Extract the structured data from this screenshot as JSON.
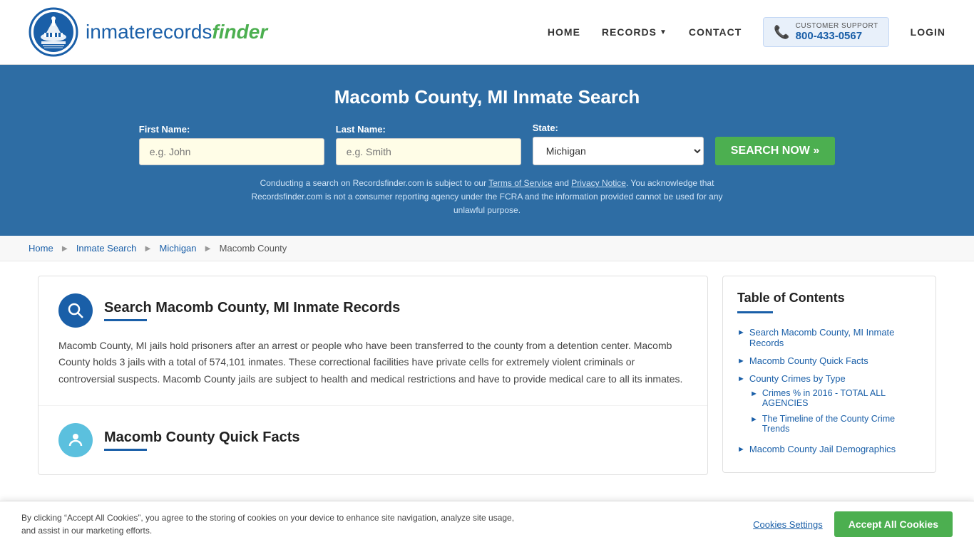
{
  "header": {
    "logo_text_part1": "inmaterecords",
    "logo_text_part2": "finder",
    "nav": {
      "home": "HOME",
      "records": "RECORDS",
      "contact": "CONTACT",
      "login": "LOGIN"
    },
    "support": {
      "label": "CUSTOMER SUPPORT",
      "phone": "800-433-0567"
    }
  },
  "hero": {
    "title": "Macomb County, MI Inmate Search",
    "form": {
      "first_name_label": "First Name:",
      "first_name_placeholder": "e.g. John",
      "last_name_label": "Last Name:",
      "last_name_placeholder": "e.g. Smith",
      "state_label": "State:",
      "state_value": "Michigan",
      "search_button": "SEARCH NOW »"
    },
    "disclaimer": "Conducting a search on Recordsfinder.com is subject to our Terms of Service and Privacy Notice. You acknowledge that Recordsfinder.com is not a consumer reporting agency under the FCRA and the information provided cannot be used for any unlawful purpose."
  },
  "breadcrumb": {
    "home": "Home",
    "inmate_search": "Inmate Search",
    "michigan": "Michigan",
    "current": "Macomb County"
  },
  "main_section": {
    "title": "Search Macomb County, MI Inmate Records",
    "body": "Macomb County, MI jails hold prisoners after an arrest or people who have been transferred to the county from a detention center. Macomb County holds 3 jails with a total of 574,101 inmates. These correctional facilities have private cells for extremely violent criminals or controversial suspects. Macomb County jails are subject to health and medical restrictions and have to provide medical care to all its inmates."
  },
  "quick_facts": {
    "title": "Macomb County Quick Facts"
  },
  "toc": {
    "title": "Table of Contents",
    "items": [
      {
        "label": "Search Macomb County, MI Inmate Records",
        "sub": []
      },
      {
        "label": "Macomb County Quick Facts",
        "sub": []
      },
      {
        "label": "County Crimes by Type",
        "sub": [
          {
            "label": "Crimes % in 2016 - TOTAL ALL AGENCIES"
          },
          {
            "label": "The Timeline of the County Crime Trends"
          }
        ]
      },
      {
        "label": "Macomb County Jail Demographics",
        "sub": []
      }
    ]
  },
  "cookie_banner": {
    "text": "By clicking “Accept All Cookies”, you agree to the storing of cookies on your device to enhance site navigation, analyze site usage, and assist in our marketing efforts.",
    "settings_btn": "Cookies Settings",
    "accept_btn": "Accept All Cookies"
  }
}
